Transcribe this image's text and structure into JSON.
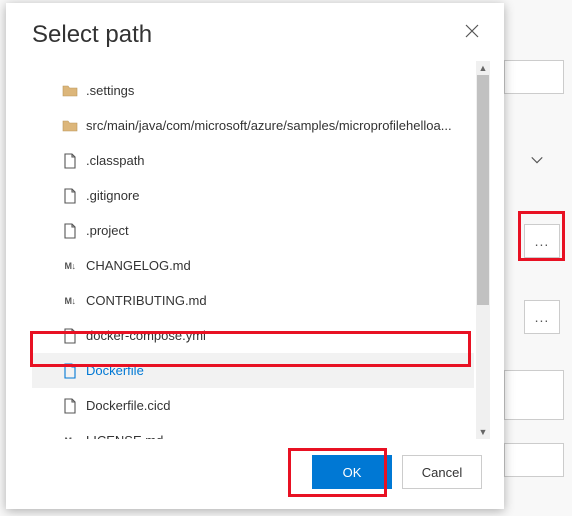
{
  "dialog": {
    "title": "Select path",
    "close_label": "Close",
    "ok_label": "OK",
    "cancel_label": "Cancel"
  },
  "tree": {
    "items": [
      {
        "icon": "folder",
        "label": ".settings",
        "selected": false,
        "interactable": true
      },
      {
        "icon": "folder",
        "label": "src/main/java/com/microsoft/azure/samples/microprofilehelloa...",
        "selected": false,
        "interactable": true
      },
      {
        "icon": "file",
        "label": ".classpath",
        "selected": false,
        "interactable": true
      },
      {
        "icon": "file",
        "label": ".gitignore",
        "selected": false,
        "interactable": true
      },
      {
        "icon": "file",
        "label": ".project",
        "selected": false,
        "interactable": true
      },
      {
        "icon": "markdown",
        "label": "CHANGELOG.md",
        "selected": false,
        "interactable": true
      },
      {
        "icon": "markdown",
        "label": "CONTRIBUTING.md",
        "selected": false,
        "interactable": true
      },
      {
        "icon": "file",
        "label": "docker-compose.yml",
        "selected": false,
        "interactable": true
      },
      {
        "icon": "file",
        "label": "Dockerfile",
        "selected": true,
        "interactable": true
      },
      {
        "icon": "file",
        "label": "Dockerfile.cicd",
        "selected": false,
        "interactable": true
      },
      {
        "icon": "markdown",
        "label": "LICENSE.md",
        "selected": false,
        "interactable": true
      }
    ]
  },
  "background": {
    "ellipsis": "..."
  },
  "colors": {
    "accent": "#0078d4",
    "highlight": "#e81123",
    "folder": "#dcb67a"
  }
}
